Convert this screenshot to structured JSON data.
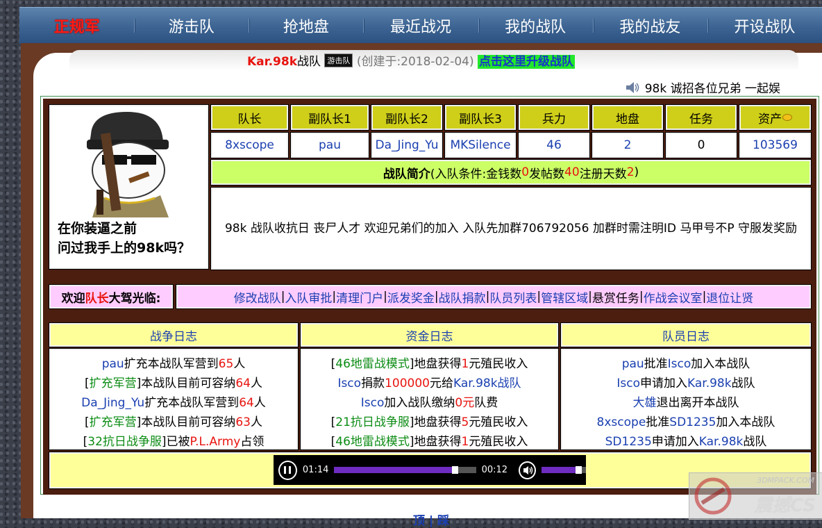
{
  "nav": {
    "items": [
      "正规军",
      "游击队",
      "抢地盘",
      "最近战况",
      "我的战队",
      "我的战友",
      "开设战队"
    ]
  },
  "header": {
    "team_name": "Kar.98k",
    "team_suffix": "战队",
    "badge": "游击队",
    "created": "(创建于:2018-02-04)",
    "upgrade_link": "点击这里升级战队"
  },
  "recruit_text": "98k 诚招各位兄弟 一起娱",
  "avatar": {
    "caption_line1": "在你装逼之前",
    "caption_line2": "问过我手上的98k吗？"
  },
  "stats": {
    "headers": [
      "队长",
      "副队长1",
      "副队长2",
      "副队长3",
      "兵力",
      "地盘",
      "任务",
      "资产"
    ],
    "values": [
      "8xscope",
      "pau",
      "Da_Jing_Yu",
      "MKSilence",
      "46",
      "2",
      "0",
      "103569"
    ]
  },
  "intro": {
    "title": "战队简介",
    "cond_prefix": "(入队条件:金钱数",
    "money": "0",
    "posts_label": " 发帖数",
    "posts": "40",
    "days_label": " 注册天数",
    "days": "2",
    "cond_suffix": ")",
    "body": "98k 战队收抗日 丧尸人才 欢迎兄弟们的加入 入队先加群706792056 加群时需注明ID 马甲号不P 守服发奖励"
  },
  "welcome": {
    "prefix": "欢迎",
    "role": "队长",
    "suffix": "大驾光临:"
  },
  "menu": [
    "修改战队",
    "入队审批",
    "清理门户",
    "派发奖金",
    "战队捐款",
    "队员列表",
    "管辖区域",
    "悬赏任务",
    "作战会议室",
    "退位让贤"
  ],
  "logs": {
    "war_title": "战争日志",
    "fund_title": "资金日志",
    "member_title": "队员日志",
    "war": [
      [
        {
          "t": "pau",
          "c": "blue"
        },
        {
          "t": "扩充本战队军营到",
          "c": "black"
        },
        {
          "t": "65",
          "c": "red"
        },
        {
          "t": "人",
          "c": "black"
        }
      ],
      [
        {
          "t": "[",
          "c": "black"
        },
        {
          "t": "扩充军营",
          "c": "green"
        },
        {
          "t": "]本战队目前可容纳",
          "c": "black"
        },
        {
          "t": "64",
          "c": "red"
        },
        {
          "t": "人",
          "c": "black"
        }
      ],
      [
        {
          "t": "Da_Jing_Yu",
          "c": "blue"
        },
        {
          "t": "扩充本战队军营到",
          "c": "black"
        },
        {
          "t": "64",
          "c": "red"
        },
        {
          "t": "人",
          "c": "black"
        }
      ],
      [
        {
          "t": "[",
          "c": "black"
        },
        {
          "t": "扩充军营",
          "c": "green"
        },
        {
          "t": "]本战队目前可容纳",
          "c": "black"
        },
        {
          "t": "63",
          "c": "red"
        },
        {
          "t": "人",
          "c": "black"
        }
      ],
      [
        {
          "t": "[",
          "c": "black"
        },
        {
          "t": "32抗日战争服",
          "c": "green"
        },
        {
          "t": "]已被",
          "c": "black"
        },
        {
          "t": "P.L.Army",
          "c": "red"
        },
        {
          "t": "占领",
          "c": "black"
        }
      ]
    ],
    "fund": [
      [
        {
          "t": "[",
          "c": "black"
        },
        {
          "t": "46地雷战模式",
          "c": "green"
        },
        {
          "t": "]地盘获得",
          "c": "black"
        },
        {
          "t": "1",
          "c": "red"
        },
        {
          "t": "元殖民收入",
          "c": "black"
        }
      ],
      [
        {
          "t": "Isco",
          "c": "blue"
        },
        {
          "t": "捐款",
          "c": "black"
        },
        {
          "t": "100000",
          "c": "red"
        },
        {
          "t": "元给",
          "c": "black"
        },
        {
          "t": "Kar.98k战队",
          "c": "blue"
        }
      ],
      [
        {
          "t": "Isco",
          "c": "blue"
        },
        {
          "t": "加入战队缴纳",
          "c": "black"
        },
        {
          "t": "0元",
          "c": "red"
        },
        {
          "t": "队费",
          "c": "black"
        }
      ],
      [
        {
          "t": "[",
          "c": "black"
        },
        {
          "t": "21抗日战争服",
          "c": "green"
        },
        {
          "t": "]地盘获得",
          "c": "black"
        },
        {
          "t": "5",
          "c": "red"
        },
        {
          "t": "元殖民收入",
          "c": "black"
        }
      ],
      [
        {
          "t": "[",
          "c": "black"
        },
        {
          "t": "46地雷战模式",
          "c": "green"
        },
        {
          "t": "]地盘获得",
          "c": "black"
        },
        {
          "t": "1",
          "c": "red"
        },
        {
          "t": "元殖民收入",
          "c": "black"
        }
      ]
    ],
    "member": [
      [
        {
          "t": "pau",
          "c": "blue"
        },
        {
          "t": "批准",
          "c": "black"
        },
        {
          "t": "Isco",
          "c": "blue"
        },
        {
          "t": "加入本战队",
          "c": "black"
        }
      ],
      [
        {
          "t": "Isco",
          "c": "blue"
        },
        {
          "t": "申请加入",
          "c": "black"
        },
        {
          "t": "Kar.98k",
          "c": "blue"
        },
        {
          "t": "战队",
          "c": "black"
        }
      ],
      [
        {
          "t": "大雄",
          "c": "blue"
        },
        {
          "t": "退出离开本战队",
          "c": "black"
        }
      ],
      [
        {
          "t": "8xscope",
          "c": "blue"
        },
        {
          "t": "批准",
          "c": "black"
        },
        {
          "t": "SD1235",
          "c": "blue"
        },
        {
          "t": "加入本战队",
          "c": "black"
        }
      ],
      [
        {
          "t": "SD1235",
          "c": "blue"
        },
        {
          "t": "申请加入",
          "c": "black"
        },
        {
          "t": "Kar.98k",
          "c": "blue"
        },
        {
          "t": "战队",
          "c": "black"
        }
      ]
    ]
  },
  "player": {
    "current_time": "01:14",
    "remaining_time": "00:12",
    "progress": 0.86,
    "volume": 0.85
  },
  "bottom_text": "顶 | 踩",
  "watermark": {
    "line1": "3DMPACK.COM",
    "line2": "震撼CS"
  }
}
